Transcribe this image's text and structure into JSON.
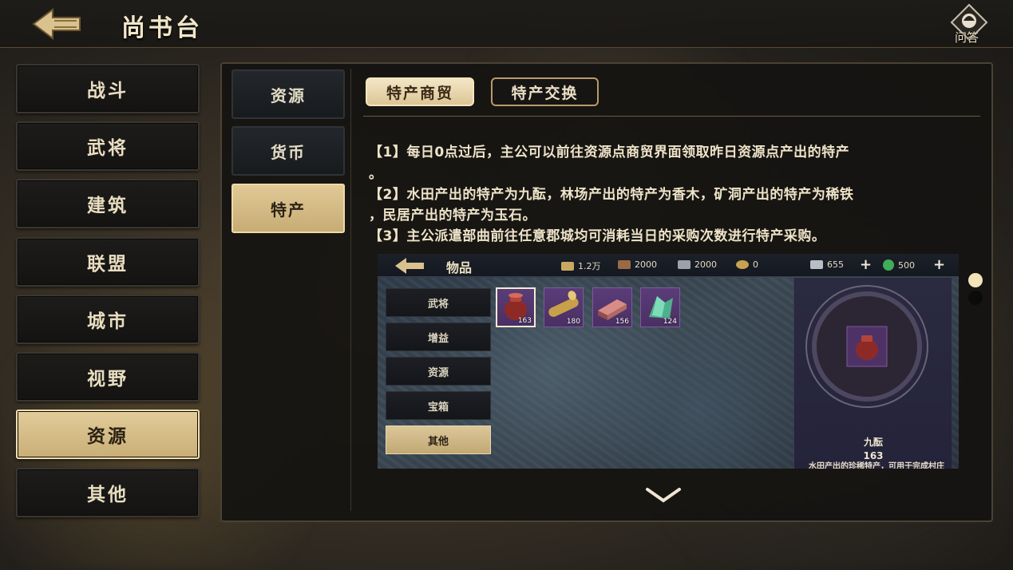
{
  "header": {
    "title": "尚书台",
    "help_label": "问答"
  },
  "categories": [
    {
      "label": "战斗",
      "active": false
    },
    {
      "label": "武将",
      "active": false
    },
    {
      "label": "建筑",
      "active": false
    },
    {
      "label": "联盟",
      "active": false
    },
    {
      "label": "城市",
      "active": false
    },
    {
      "label": "视野",
      "active": false
    },
    {
      "label": "资源",
      "active": true
    },
    {
      "label": "其他",
      "active": false
    }
  ],
  "subcategories": [
    {
      "label": "资源",
      "active": false
    },
    {
      "label": "货币",
      "active": false
    },
    {
      "label": "特产",
      "active": true
    }
  ],
  "tabs": [
    {
      "label": "特产商贸",
      "active": true
    },
    {
      "label": "特产交换",
      "active": false
    }
  ],
  "description": [
    "【1】每日0点过后，主公可以前往资源点商贸界面领取昨日资源点产出的特产",
    "。",
    "【2】水田产出的特产为九酝，林场产出的特产为香木，矿洞产出的特产为稀铁",
    "，民居产出的特产为玉石。",
    "【3】主公派遣部曲前往任意郡城均可消耗当日的采购次数进行特产采购。"
  ],
  "screenshot": {
    "title": "物品",
    "resources": [
      {
        "icon": "grain-icon",
        "value": "1.2万"
      },
      {
        "icon": "wood-icon",
        "value": "2000"
      },
      {
        "icon": "iron-icon",
        "value": "2000"
      },
      {
        "icon": "copper-coin-icon",
        "value": "0"
      },
      {
        "icon": "jade-ingot-icon",
        "value": "655"
      },
      {
        "icon": "gem-icon",
        "value": "500"
      }
    ],
    "plus": "+",
    "side_tabs": [
      {
        "label": "武将",
        "active": false
      },
      {
        "label": "增益",
        "active": false
      },
      {
        "label": "资源",
        "active": false
      },
      {
        "label": "宝箱",
        "active": false
      },
      {
        "label": "其他",
        "active": true
      }
    ],
    "items": [
      {
        "icon": "wine-jar-icon",
        "count": "163"
      },
      {
        "icon": "fragrant-wood-icon",
        "count": "180"
      },
      {
        "icon": "rare-iron-icon",
        "count": "156"
      },
      {
        "icon": "jade-stone-icon",
        "count": "124"
      }
    ],
    "detail": {
      "name": "九酝",
      "count": "163",
      "desc": "水田产出的珍稀特产，可用于完成村庄商贸任务。郡城每日也有"
    }
  },
  "colors": {
    "accent_gold": "#d8c08a",
    "panel_dark": "#141312",
    "text_light": "#eee3c8"
  }
}
